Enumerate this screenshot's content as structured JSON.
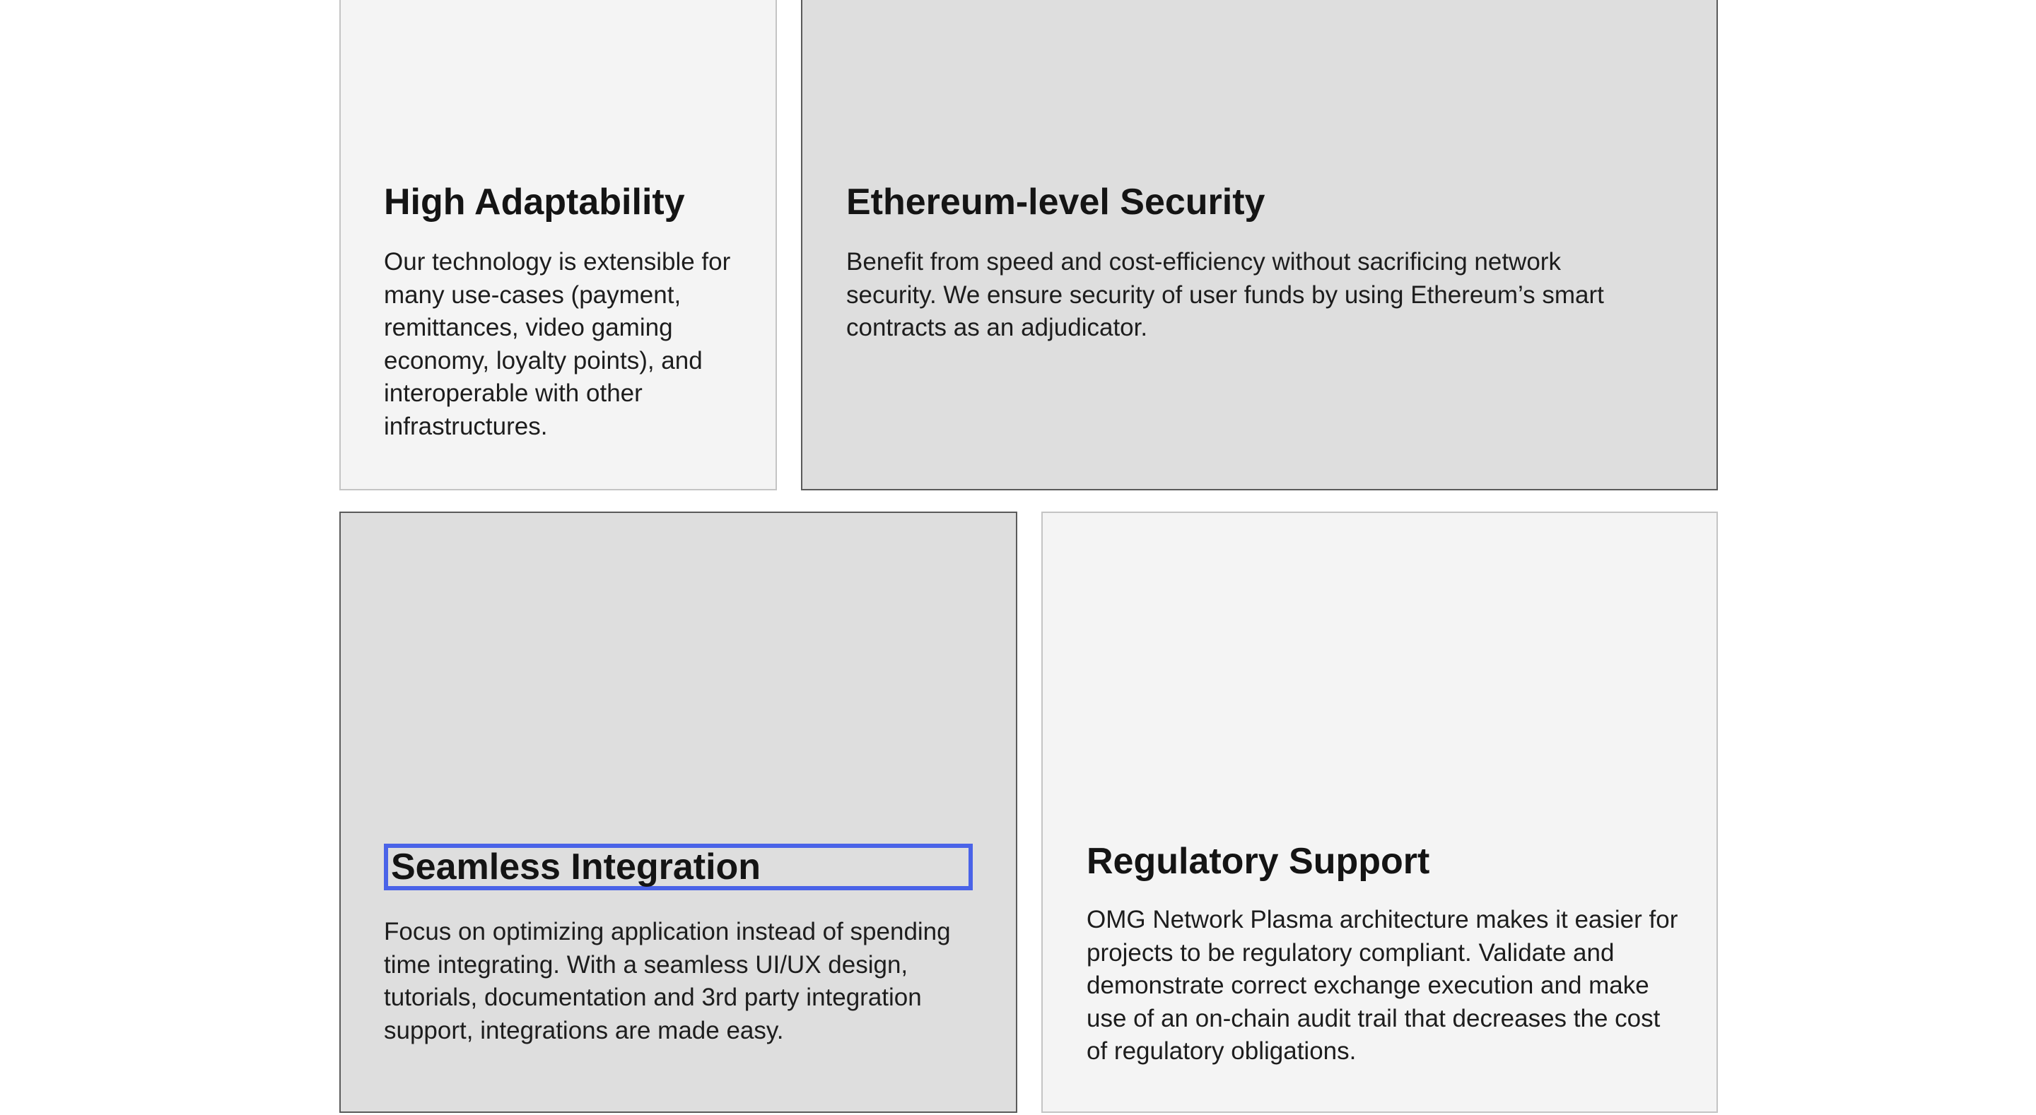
{
  "features": [
    {
      "title": "High Adaptability",
      "body": "Our technology is extensible for many use-cases (payment, remittances, video gaming economy, loyalty points), and interoperable with other infrastructures."
    },
    {
      "title": "Ethereum-level Security",
      "body": "Benefit from speed and cost-efficiency without sacrificing network security. We ensure security of user funds by using Ethereum’s smart contracts as an adjudicator."
    },
    {
      "title": "Seamless Integration",
      "body": "Focus on optimizing application instead of spending time integrating. With a seamless UI/UX design, tutorials, documentation and 3rd party integration support, integrations are made easy."
    },
    {
      "title": "Regulatory Support",
      "body": "OMG Network Plasma architecture makes it easier for projects to be regulatory compliant. Validate and demonstrate correct exchange execution and make use of an on-chain audit trail that decreases the cost of regulatory obligations."
    }
  ],
  "colors": {
    "light_card": "#f4f4f4",
    "dark_card": "#dedede",
    "focus_outline": "#4a63e8"
  }
}
